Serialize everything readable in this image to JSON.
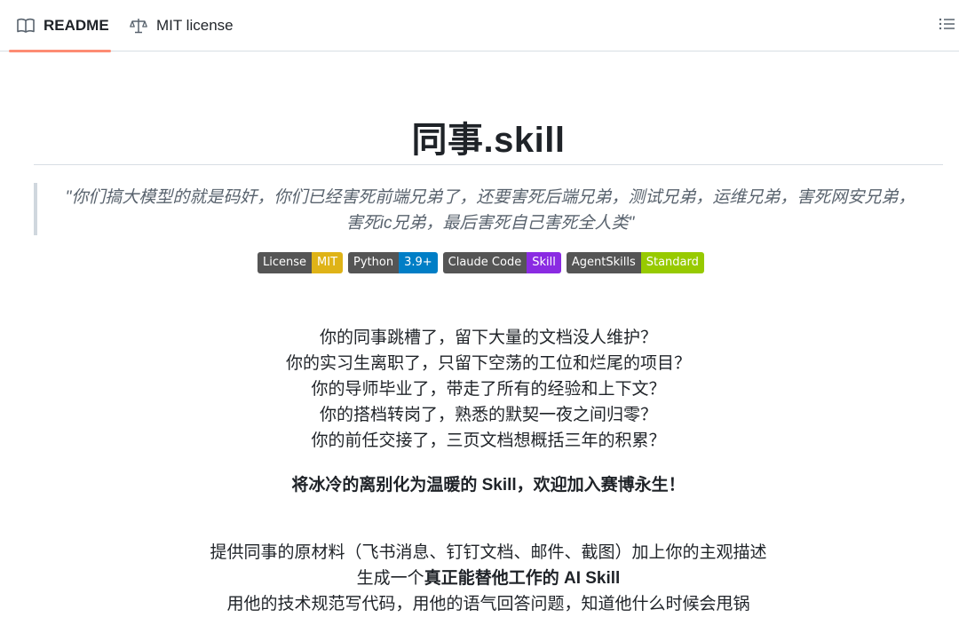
{
  "tabs": [
    {
      "label": "README",
      "icon": "book-icon",
      "active": true
    },
    {
      "label": "MIT license",
      "icon": "scale-icon",
      "active": false
    }
  ],
  "toc_icon": "list-icon",
  "readme": {
    "title": "同事.skill",
    "quote": "\"你们搞大模型的就是码奸，你们已经害死前端兄弟了，还要害死后端兄弟，测试兄弟，运维兄弟，害死网安兄弟，害死ic兄弟，最后害死自己害死全人类\"",
    "badges": [
      {
        "label": "License",
        "value": "MIT",
        "color": "#dfb317"
      },
      {
        "label": "Python",
        "value": "3.9+",
        "color": "#007ec6"
      },
      {
        "label": "Claude Code",
        "value": "Skill",
        "color": "#8a2be2"
      },
      {
        "label": "AgentSkills",
        "value": "Standard",
        "color": "#97ca00"
      }
    ],
    "intro_lines": [
      "你的同事跳槽了，留下大量的文档没人维护？",
      "你的实习生离职了，只留下空荡的工位和烂尾的项目？",
      "你的导师毕业了，带走了所有的经验和上下文？",
      "你的搭档转岗了，熟悉的默契一夜之间归零？",
      "你的前任交接了，三页文档想概括三年的积累？"
    ],
    "tagline": "将冰冷的离别化为温暖的 Skill，欢迎加入赛博永生！",
    "desc_line1": "提供同事的原材料（飞书消息、钉钉文档、邮件、截图）加上你的主观描述",
    "desc_line2_prefix": "生成一个",
    "desc_line2_bold": "真正能替他工作的 AI Skill",
    "desc_line3": "用他的技术规范写代码，用他的语气回答问题，知道他什么时候会甩锅"
  }
}
